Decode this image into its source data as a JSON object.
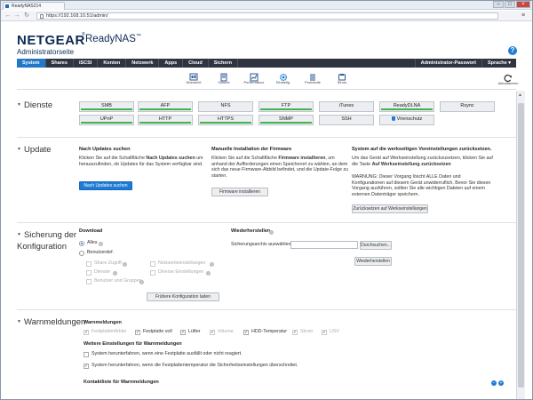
{
  "browser": {
    "tab_title": "ReadyNAS214",
    "url": "https://192.168.10.51/admin/"
  },
  "brand": {
    "logo": "NETGEAR",
    "product": "ReadyNAS",
    "product_tm": "™",
    "subtitle": "Administratorseite",
    "help": "?"
  },
  "nav": {
    "items": [
      "System",
      "Shares",
      "iSCSI",
      "Konten",
      "Netzwerk",
      "Apps",
      "Cloud",
      "Sichern"
    ],
    "admin_password": "Administrator-Passwort",
    "language": "Sprache ▾"
  },
  "toolbar": {
    "items": [
      {
        "label": "Übersicht",
        "icon": "dashboard-icon"
      },
      {
        "label": "Volume",
        "icon": "volume-icon"
      },
      {
        "label": "Performance",
        "icon": "performance-icon"
      },
      {
        "label": "Einstellg.",
        "icon": "gear-icon"
      },
      {
        "label": "Protokolle",
        "icon": "logs-icon"
      },
      {
        "label": "Strom",
        "icon": "power-icon"
      }
    ],
    "refresh_label": "Aktualisieren"
  },
  "dienste": {
    "title": "Dienste",
    "services": [
      {
        "label": "SMB",
        "on": true
      },
      {
        "label": "AFP",
        "on": true
      },
      {
        "label": "NFS",
        "on": false
      },
      {
        "label": "FTP",
        "on": true
      },
      {
        "label": "iTunes",
        "on": false
      },
      {
        "label": "ReadyDLNA",
        "on": true
      },
      {
        "label": "Rsync",
        "on": false
      },
      {
        "label": "UPnP",
        "on": true
      },
      {
        "label": "HTTP",
        "on": true
      },
      {
        "label": "HTTPS",
        "on": true
      },
      {
        "label": "SNMP",
        "on": true
      },
      {
        "label": "SSH",
        "on": false
      },
      {
        "label": "Virenschutz",
        "on": false
      }
    ]
  },
  "update": {
    "title": "Update",
    "col1": {
      "heading": "Nach Updates suchen",
      "text_a": "Klicken Sie auf die Schaltfläche ",
      "text_b": "Nach Updates suchen",
      "text_c": " um herauszufinden, ob Updates für das System verfügbar sind.",
      "button": "Nach Updates suchen"
    },
    "col2": {
      "heading": "Manuelle Installation der Firmware",
      "text_a": "Klicken Sie auf die Schaltfläche ",
      "text_b": "Firmware installieren",
      "text_c": ", um anhand der Aufforderungen einen Speicherort zu wählen, an dem sich das neue Firmware-Abbild befindet, und die Update-Folge zu starten.",
      "button": "Firmware installieren"
    },
    "col3": {
      "heading": "System auf die werkseitigen Voreinstellungen zurücksetzen.",
      "text_a": "Um das Gerät auf Werkseinstellung zurückzusetzen, klicken Sie auf die Taste ",
      "text_b": "Auf Werkseinstellung zurücksetzen",
      "warning": "WARNUNG: Dieser Vorgang löscht ALLE Daten und Konfigurationen auf diesem Gerät unwiderruflich. Bevor Sie diesen Vorgang ausführen, sollten Sie alle wichtigen Dateien auf einem externen Datenträger speichern.",
      "button": "Zurücksetzen auf Werkseinstellungen"
    }
  },
  "sicherung": {
    "title_line1": "Sicherung der",
    "title_line2": "Konfiguration",
    "download": {
      "heading": "Download",
      "all": "Alles",
      "custom": "Benutzerdef.",
      "share_access": "Share-Zugriff",
      "network_settings": "Netzwerkeinstellungen",
      "services": "Dienste",
      "misc_settings": "Diverse Einstellungen",
      "users_groups": "Benutzer und Gruppen",
      "load_button": "Frühere Konfiguration laden"
    },
    "restore": {
      "heading": "Wiederherstellen",
      "select_label": "Sicherungsarchiv auswählen:",
      "browse": "Durchsuchen...",
      "restore_button": "Wiederherstellen"
    }
  },
  "warn": {
    "title": "Warnmeldungen",
    "heading": "Warnmeldungen",
    "items": [
      {
        "label": "Festplattenfehler",
        "checked": true,
        "disabled": true
      },
      {
        "label": "Festplatte voll",
        "checked": true,
        "disabled": false
      },
      {
        "label": "Lüfter",
        "checked": true,
        "disabled": false
      },
      {
        "label": "Volume",
        "checked": true,
        "disabled": true
      },
      {
        "label": "HDD-Temperatur",
        "checked": true,
        "disabled": false
      },
      {
        "label": "Strom",
        "checked": true,
        "disabled": true
      },
      {
        "label": "USV",
        "checked": true,
        "disabled": true
      }
    ],
    "more_heading": "Weitere Einstellungen für Warnmeldungen",
    "opt1": "System herunterfahren, wenn eine Festplatte ausfällt oder nicht reagiert.",
    "opt2": "System herunterfahren, wenn die Festplattentemperatur die Sicherheitseinstellungen überschreitet.",
    "contacts": "Kontaktliste für Warnmeldungen"
  }
}
